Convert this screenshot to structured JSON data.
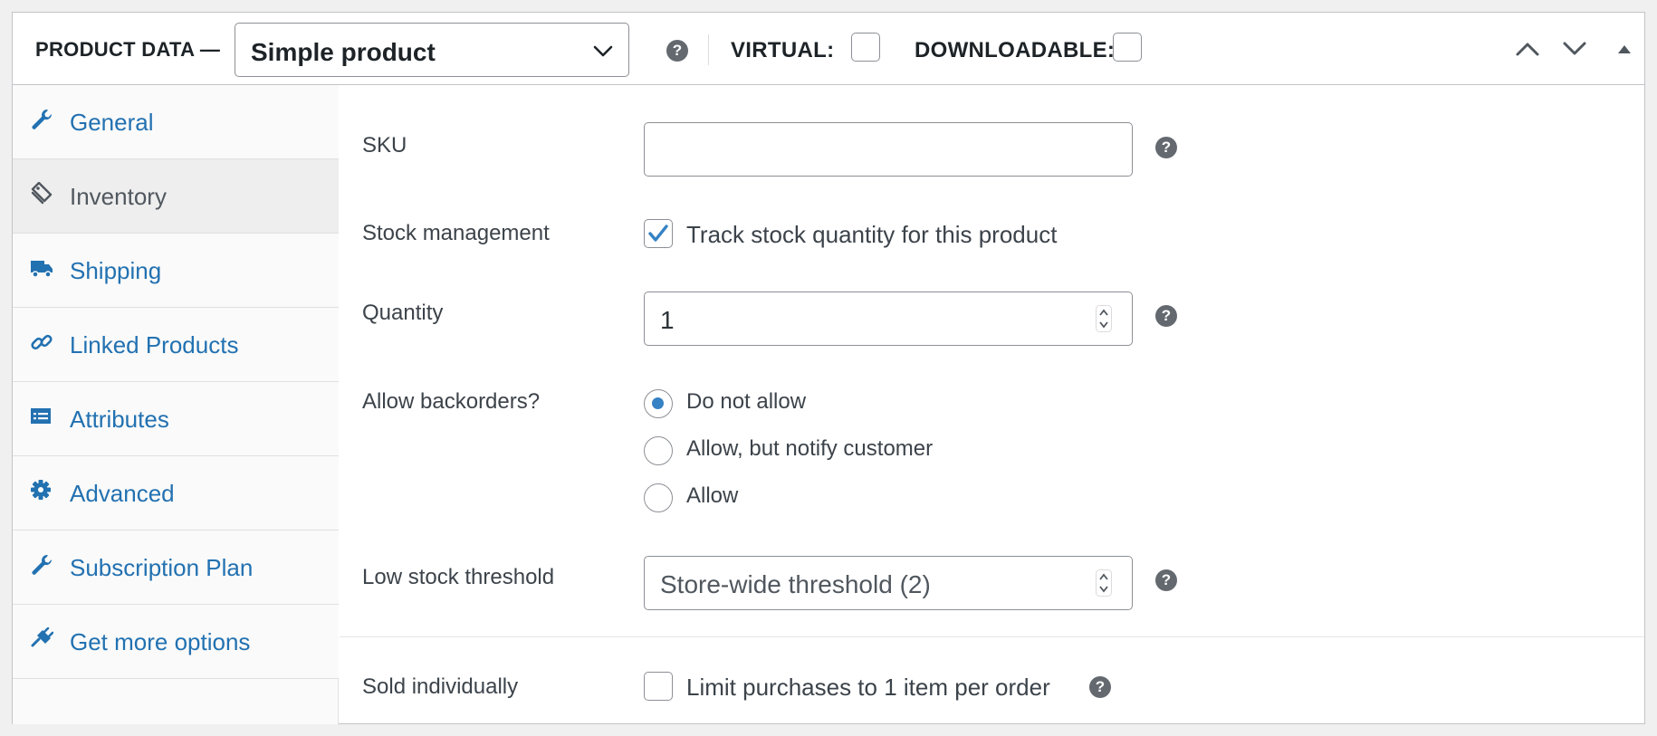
{
  "header": {
    "title": "PRODUCT DATA —",
    "product_type": "Simple product",
    "help_glyph": "?",
    "virtual_label": "VIRTUAL:",
    "virtual_checked": false,
    "downloadable_label": "DOWNLOADABLE:",
    "downloadable_checked": false,
    "controls": [
      "chevron-up-icon",
      "chevron-down-icon",
      "triangle-up-icon"
    ]
  },
  "sidebar": {
    "active": "Inventory",
    "items": [
      {
        "label": "General",
        "icon": "wrench-icon"
      },
      {
        "label": "Inventory",
        "icon": "tag-icon"
      },
      {
        "label": "Shipping",
        "icon": "truck-icon"
      },
      {
        "label": "Linked Products",
        "icon": "link-icon"
      },
      {
        "label": "Attributes",
        "icon": "list-card-icon"
      },
      {
        "label": "Advanced",
        "icon": "gear-icon"
      },
      {
        "label": "Subscription Plan",
        "icon": "wrench-icon"
      },
      {
        "label": "Get more options",
        "icon": "plugin-icon"
      }
    ]
  },
  "inventory": {
    "sku": {
      "label": "SKU",
      "value": ""
    },
    "stock_management": {
      "label": "Stock management",
      "checkbox_label": "Track stock quantity for this product",
      "checked": true
    },
    "quantity": {
      "label": "Quantity",
      "value": "1"
    },
    "backorders": {
      "label": "Allow backorders?",
      "options": [
        "Do not allow",
        "Allow, but notify customer",
        "Allow"
      ],
      "selected": "Do not allow"
    },
    "low_stock": {
      "label": "Low stock threshold",
      "placeholder": "Store-wide threshold (2)"
    },
    "sold_individually": {
      "label": "Sold individually",
      "checkbox_label": "Limit purchases to 1 item per order",
      "checked": false
    }
  },
  "colors": {
    "link": "#2271b1",
    "accent": "#3582c4",
    "help_icon": "#646970",
    "border": "#8c8f94"
  }
}
